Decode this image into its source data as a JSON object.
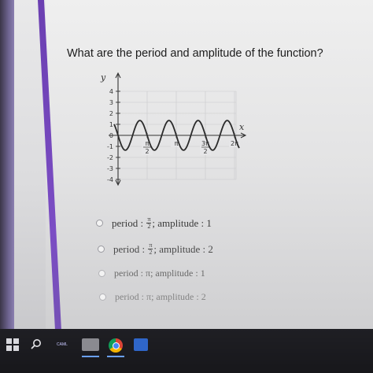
{
  "question": {
    "text": "What are the period and amplitude of the function?"
  },
  "graph": {
    "y_axis_label": "y",
    "x_axis_label": "x",
    "y_ticks": [
      "4",
      "3",
      "2",
      "1",
      "0",
      "-1",
      "-2",
      "-3",
      "-4"
    ],
    "x_ticks": [
      {
        "num": "π",
        "den": "2"
      },
      {
        "num": "π",
        "den": ""
      },
      {
        "num": "3π",
        "den": "2"
      },
      {
        "num": "2π",
        "den": ""
      },
      {
        "num": "5π",
        "den": "2"
      }
    ],
    "curve_amplitude": 1,
    "curve_period": "π/2",
    "curve_color": "#2b2b2b"
  },
  "options": [
    {
      "pre": "period :",
      "frac_num": "π",
      "frac_den": "2",
      "post": "; amplitude : 1"
    },
    {
      "pre": "period :",
      "frac_num": "π",
      "frac_den": "2",
      "post": "; amplitude : 2"
    },
    {
      "pre": "period : π",
      "post": "; amplitude : 1"
    },
    {
      "pre": "period : π",
      "post": "; amplitude : 2"
    }
  ],
  "taskbar": {
    "app_1_text": "CAML",
    "icons": [
      "windows-start-icon",
      "search-icon",
      "app-icon",
      "file-icon",
      "chrome-icon",
      "word-icon"
    ]
  }
}
